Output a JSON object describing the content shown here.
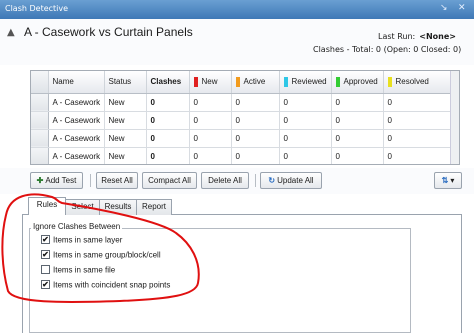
{
  "window": {
    "title": "Clash Detective",
    "pin_icon": "pin-icon",
    "close_icon": "close-icon"
  },
  "test": {
    "name": "A - Casework vs Curtain Panels",
    "last_run_label": "Last Run:",
    "last_run_value": "<None>",
    "summary": "Clashes - Total: 0 (Open: 0 Closed: 0)"
  },
  "table": {
    "headers": [
      "Name",
      "Status",
      "Clashes",
      "New",
      "Active",
      "Reviewed",
      "Approved",
      "Resolved"
    ],
    "status_colors": {
      "New": "#e02020",
      "Active": "#f29b1d",
      "Reviewed": "#2ec7e6",
      "Approved": "#33cc33",
      "Resolved": "#e8e020"
    },
    "rows": [
      [
        "A - Casework",
        "New",
        "0",
        "0",
        "0",
        "0",
        "0",
        "0"
      ],
      [
        "A - Casework",
        "New",
        "0",
        "0",
        "0",
        "0",
        "0",
        "0"
      ],
      [
        "A - Casework",
        "New",
        "0",
        "0",
        "0",
        "0",
        "0",
        "0"
      ],
      [
        "A - Casework",
        "New",
        "0",
        "0",
        "0",
        "0",
        "0",
        "0"
      ]
    ]
  },
  "toolbar": {
    "add_test": "Add Test",
    "reset_all": "Reset All",
    "compact_all": "Compact All",
    "delete_all": "Delete All",
    "update_all": "Update All"
  },
  "tabs": [
    "Rules",
    "Select",
    "Results",
    "Report"
  ],
  "rules": {
    "group_title": "Ignore Clashes Between",
    "options": [
      {
        "label": "Items in same layer",
        "checked": true
      },
      {
        "label": "Items in same group/block/cell",
        "checked": true
      },
      {
        "label": "Items in same file",
        "checked": false
      },
      {
        "label": "Items with coincident snap points",
        "checked": true
      }
    ]
  },
  "annotation": {
    "color": "#e01010"
  }
}
